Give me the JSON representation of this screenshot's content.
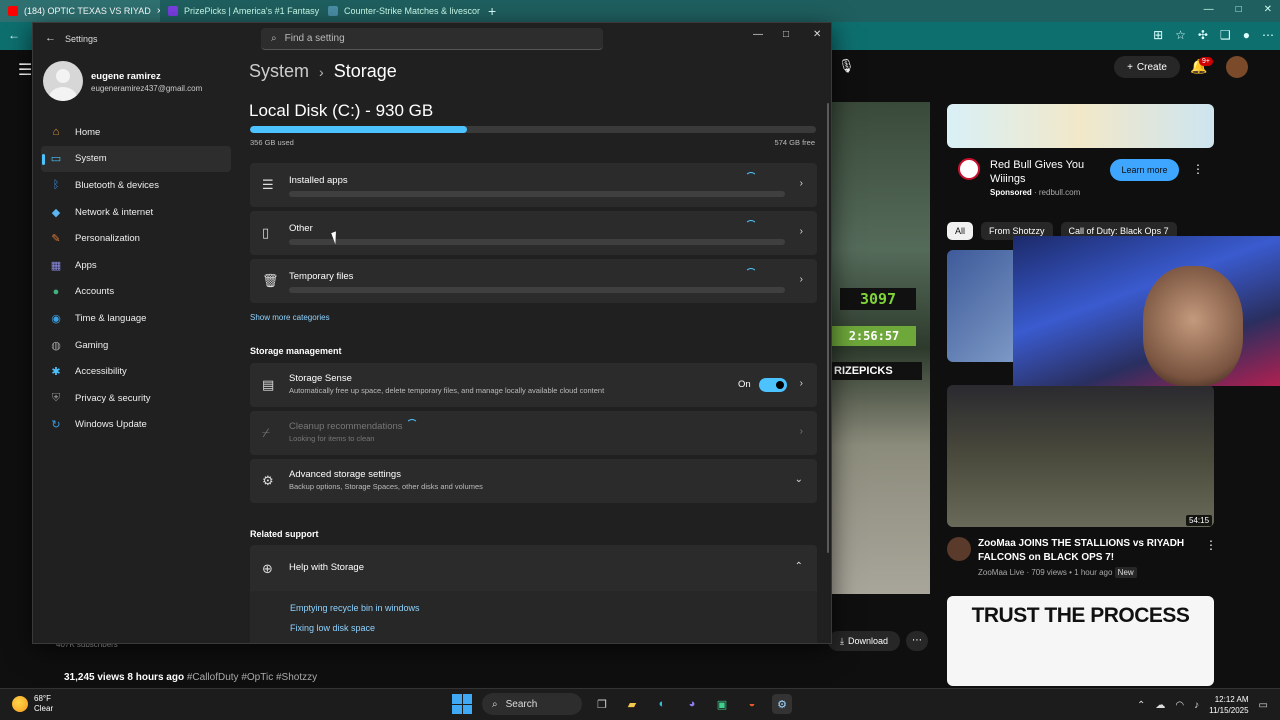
{
  "browser": {
    "tabs": [
      {
        "label": "(184) OPTIC TEXAS VS RIYAD",
        "favicon_color": "#ff0000",
        "active": true
      },
      {
        "label": "PrizePicks | America's #1 Fantasy",
        "favicon_color": "#7b3fe4",
        "active": false
      },
      {
        "label": "Counter-Strike Matches & livescore",
        "favicon_color": "#4a8fa8",
        "active": false
      }
    ]
  },
  "youtube": {
    "create_label": "Create",
    "notif_count": "9+",
    "overlay_score": "3097",
    "overlay_timer": "2:56:57",
    "overlay_brand": "RIZEPICKS",
    "ad": {
      "title": "Red Bull Gives You Wiiings",
      "sponsored": "Sponsored",
      "domain": "redbull.com",
      "cta": "Learn more"
    },
    "chips": [
      "All",
      "From Shotzzy",
      "Call of Duty: Black Ops 7"
    ],
    "rec": {
      "duration": "54:15",
      "title": "ZooMaa JOINS THE STALLIONS vs RIYADH FALCONS on BLACK OPS 7!",
      "channel": "ZooMaa Live",
      "meta": "709 views • 1 hour ago",
      "badge": "New"
    },
    "thumb3_text": "TRUST THE PROCESS",
    "subscribers": "407K subscribers",
    "views": "31,245 views",
    "age": "8 hours ago",
    "tags": "#CallofDuty #OpTic #Shotzzy",
    "download_label": "Download"
  },
  "settings": {
    "app_title": "Settings",
    "search_placeholder": "Find a setting",
    "user": {
      "name": "eugene ramirez",
      "email": "eugeneramirez437@gmail.com"
    },
    "nav": [
      {
        "label": "Home",
        "icon": "home-icon",
        "color": "#e8a13a"
      },
      {
        "label": "System",
        "icon": "monitor-icon",
        "color": "#4cc2ff"
      },
      {
        "label": "Bluetooth & devices",
        "icon": "bluetooth-icon",
        "color": "#3b8ee0"
      },
      {
        "label": "Network & internet",
        "icon": "wifi-icon",
        "color": "#5bb5f0"
      },
      {
        "label": "Personalization",
        "icon": "brush-icon",
        "color": "#e07a3a"
      },
      {
        "label": "Apps",
        "icon": "apps-icon",
        "color": "#8a8ae0"
      },
      {
        "label": "Accounts",
        "icon": "person-icon",
        "color": "#3fb27f"
      },
      {
        "label": "Time & language",
        "icon": "globe-clock-icon",
        "color": "#3b9ee0"
      },
      {
        "label": "Gaming",
        "icon": "controller-icon",
        "color": "#a0a0a0"
      },
      {
        "label": "Accessibility",
        "icon": "accessibility-icon",
        "color": "#4cc2ff"
      },
      {
        "label": "Privacy & security",
        "icon": "shield-icon",
        "color": "#8a8a8a"
      },
      {
        "label": "Windows Update",
        "icon": "refresh-icon",
        "color": "#3b9ee0"
      }
    ],
    "breadcrumb_parent": "System",
    "breadcrumb_current": "Storage",
    "disk": {
      "title": "Local Disk (C:) - 930 GB",
      "used": "356 GB used",
      "free": "574 GB free",
      "used_fraction": 0.383
    },
    "categories": [
      {
        "label": "Installed apps",
        "icon": "list-icon"
      },
      {
        "label": "Other",
        "icon": "document-icon"
      },
      {
        "label": "Temporary files",
        "icon": "trash-icon"
      }
    ],
    "show_more": "Show more categories",
    "storage_management_heading": "Storage management",
    "storage_sense": {
      "title": "Storage Sense",
      "subtitle": "Automatically free up space, delete temporary files, and manage locally available cloud content",
      "toggle_label": "On"
    },
    "cleanup": {
      "title": "Cleanup recommendations",
      "subtitle": "Looking for items to clean"
    },
    "advanced": {
      "title": "Advanced storage settings",
      "subtitle": "Backup options, Storage Spaces, other disks and volumes"
    },
    "related_support_heading": "Related support",
    "help": {
      "title": "Help with Storage",
      "links": [
        "Emptying recycle bin in windows",
        "Fixing low disk space"
      ]
    }
  },
  "taskbar": {
    "temp": "68°F",
    "weather": "Clear",
    "search_label": "Search",
    "time": "12:12 AM",
    "date": "11/15/2025"
  }
}
